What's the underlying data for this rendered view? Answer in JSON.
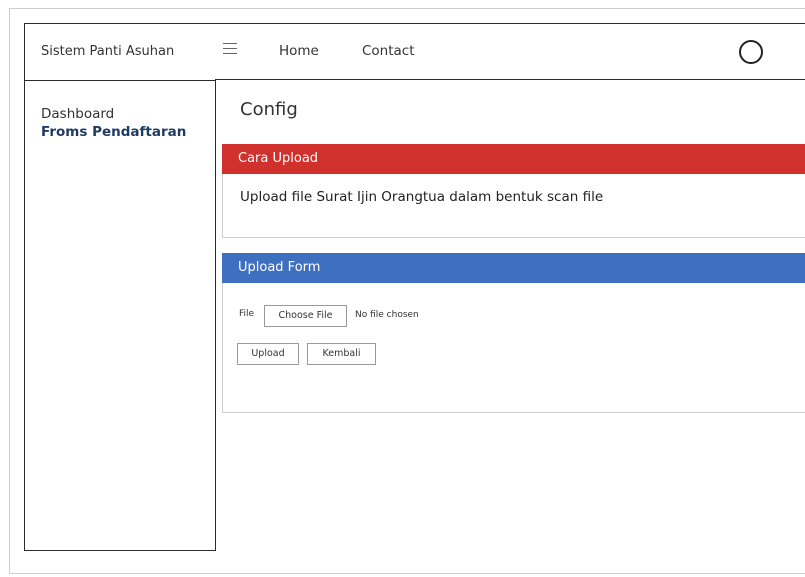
{
  "app": {
    "title": "Sistem Panti Asuhan"
  },
  "sidebar": {
    "items": [
      {
        "label": "Dashboard",
        "active": false
      },
      {
        "label": "Froms Pendaftaran",
        "active": true
      }
    ]
  },
  "topbar": {
    "menu_icon": "hamburger-icon",
    "links": [
      "Home",
      "Contact"
    ],
    "profile_icon": "user-circle-icon"
  },
  "main": {
    "title": "Config",
    "cara_upload": {
      "header": "Cara Upload",
      "header_color": "#d0312d",
      "text": "Upload file Surat Ijin Orangtua dalam bentuk scan file"
    },
    "upload_form": {
      "header": "Upload Form",
      "header_color": "#3f6fbf",
      "file_label": "File",
      "choose_label": "Choose File",
      "no_file_text": "No file chosen",
      "upload_label": "Upload",
      "back_label": "Kembali"
    }
  }
}
